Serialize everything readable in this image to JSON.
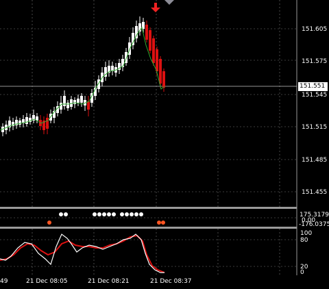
{
  "colors": {
    "background": "#000000",
    "bull_candle": "#ffffff",
    "bear_candle": "#dd1111",
    "ma_line": "#2fa82f",
    "stoch_main": "#ffffff",
    "stoch_signal": "#dd1111",
    "grid": "#7a7a7a",
    "signal_arrow": "#ee2222",
    "dot_white": "#ffffff",
    "dot_orange": "#ff5522"
  },
  "price_axis": {
    "labels": [
      "151.605",
      "151.575",
      "151.545",
      "151.515",
      "151.485",
      "151.455"
    ],
    "current_price": "151.551"
  },
  "indicator_axis": {
    "labels": [
      "175.3179",
      "0.00",
      "-176.0375"
    ]
  },
  "stoch_axis": {
    "labels": [
      "100",
      "80",
      "20",
      "0"
    ]
  },
  "time_axis": {
    "labels": [
      "49",
      "21 Dec 08:05",
      "21 Dec 08:21",
      "21 Dec 08:37"
    ]
  },
  "icons": {
    "sell_arrow": "down-arrow-icon",
    "scroll_marker": "diamond-marker-icon"
  }
}
